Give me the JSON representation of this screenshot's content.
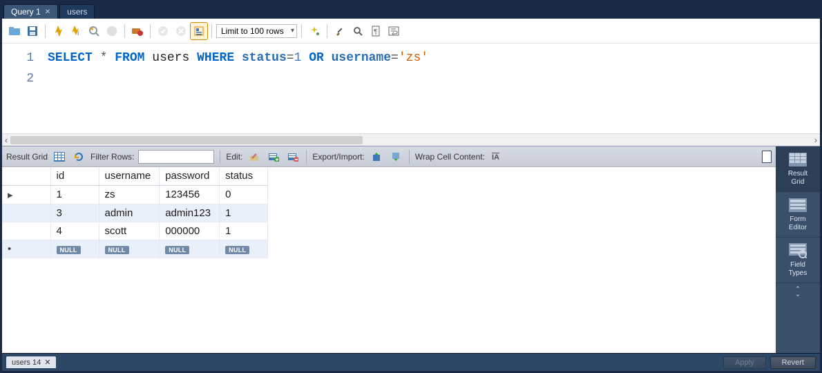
{
  "tabs": [
    {
      "label": "Query 1",
      "active": true,
      "closable": true
    },
    {
      "label": "users",
      "active": false,
      "closable": false
    }
  ],
  "toolbar": {
    "limit_label": "Limit to 100 rows"
  },
  "editor": {
    "lines": [
      "1",
      "2"
    ],
    "tokens": {
      "select": "SELECT",
      "star": "*",
      "from": "FROM",
      "table": "users",
      "where": "WHERE",
      "col_status": "status",
      "eq1": "=",
      "val1": "1",
      "or": "OR",
      "col_user": "username",
      "eq2": "=",
      "val2": "'zs'"
    }
  },
  "result_toolbar": {
    "result_grid": "Result Grid",
    "filter_rows": "Filter Rows:",
    "filter_value": "",
    "edit": "Edit:",
    "export_import": "Export/Import:",
    "wrap": "Wrap Cell Content:"
  },
  "grid": {
    "columns": [
      "id",
      "username",
      "password",
      "status"
    ],
    "rows": [
      {
        "marker": "▸",
        "cells": [
          "1",
          "zs",
          "123456",
          "0"
        ]
      },
      {
        "marker": "",
        "cells": [
          "3",
          "admin",
          "admin123",
          "1"
        ]
      },
      {
        "marker": "",
        "cells": [
          "4",
          "scott",
          "000000",
          "1"
        ]
      }
    ],
    "null_row_marker": "•",
    "null_label": "NULL"
  },
  "side_panels": {
    "result_grid": "Result\nGrid",
    "form_editor": "Form\nEditor",
    "field_types": "Field\nTypes"
  },
  "footer": {
    "mini_tab": "users 14",
    "apply": "Apply",
    "revert": "Revert"
  }
}
